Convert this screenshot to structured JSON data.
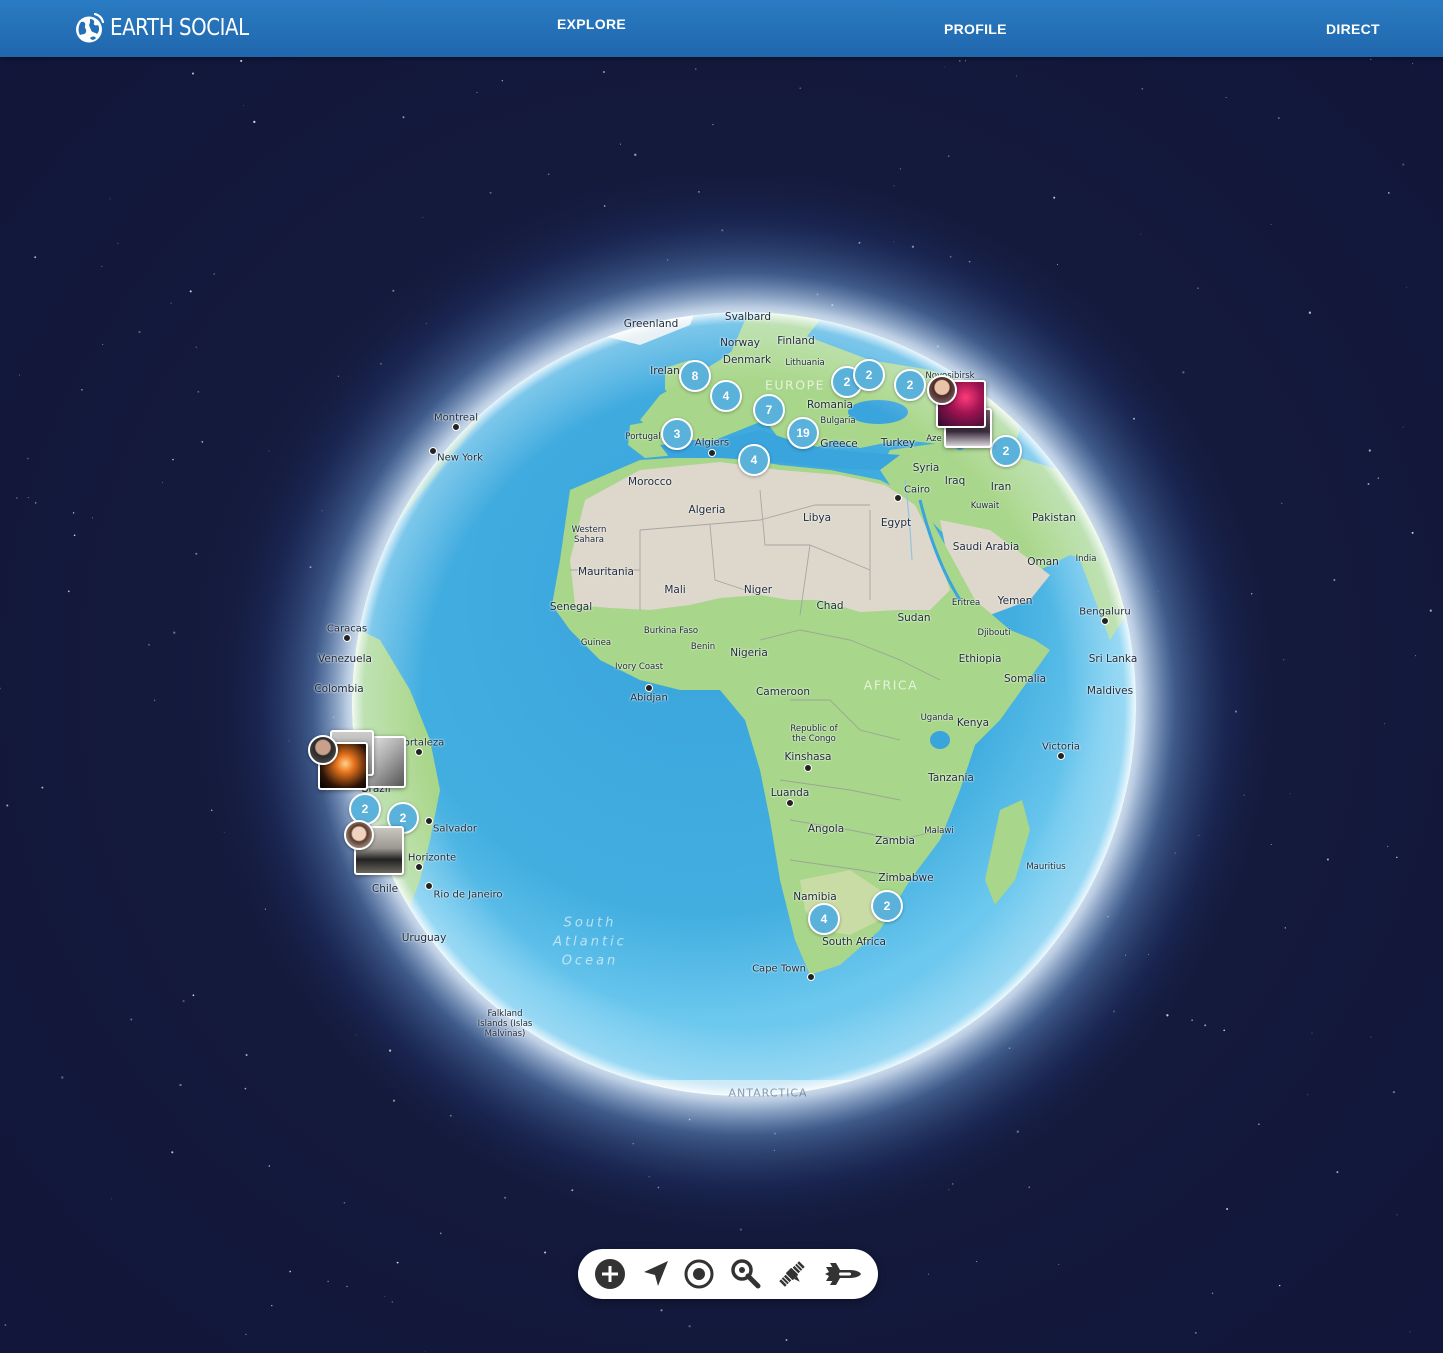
{
  "app": {
    "title": "EARTH SOCIAL",
    "logo_icon": "globe-icon"
  },
  "nav": {
    "explore": "EXPLORE",
    "profile": "PROFILE",
    "direct": "DIRECT"
  },
  "colors": {
    "header": "#2470b8",
    "space": "#141a3c",
    "ocean": "#3fa9dc",
    "land_green": "#a8d68a",
    "desert": "#dcd6cb",
    "cluster": "#5ab2db"
  },
  "globe": {
    "labels": {
      "greenland": "Greenland",
      "svalbard": "Svalbard",
      "finland": "Finland",
      "norway": "Norway",
      "denmark": "Denmark",
      "lithuania": "Lithuania",
      "ireland": "Irelan",
      "europe": "EUROPE",
      "novosibirsk": "Novosibirsk",
      "romania": "Romania",
      "bulgaria": "Bulgaria",
      "greece": "Greece",
      "turkey": "Turkey",
      "portugal": "Portugal",
      "algiers": "Algiers",
      "azerbaijan": "Aze",
      "montreal": "Montreal",
      "new_york": "New York",
      "syria": "Syria",
      "iraq": "Iraq",
      "iran": "Iran",
      "cairo": "Cairo",
      "morocco": "Morocco",
      "kuwait": "Kuwait",
      "pakistan": "Pakistan",
      "algeria": "Algeria",
      "libya": "Libya",
      "egypt": "Egypt",
      "western_sahara": "Western\nSahara",
      "saudi_arabia": "Saudi Arabia",
      "india": "India",
      "oman": "Oman",
      "mauritania": "Mauritania",
      "mali": "Mali",
      "niger": "Niger",
      "senegal": "Senegal",
      "chad": "Chad",
      "eritrea": "Eritrea",
      "yemen": "Yemen",
      "bengaluru": "Bengaluru",
      "sudan": "Sudan",
      "caracas": "Caracas",
      "guinea": "Guinea",
      "burkina_faso": "Burkina Faso",
      "benin": "Benin",
      "djibouti": "Djibouti",
      "nigeria": "Nigeria",
      "venezuela": "Venezuela",
      "ethiopia": "Ethiopia",
      "sri_lanka": "Sri Lanka",
      "ivory_coast": "Ivory Coast",
      "colombia": "Colombia",
      "abidjan": "Abidjan",
      "somalia": "Somalia",
      "cameroon": "Cameroon",
      "africa": "AFRICA",
      "maldives": "Maldives",
      "uganda": "Uganda",
      "kenya": "Kenya",
      "fortaleza": "ortaleza",
      "republic_congo": "Republic of\nthe Congo",
      "victoria": "Victoria",
      "kinshasa": "Kinshasa",
      "tanzania": "Tanzania",
      "brazil": "Brazil",
      "luanda": "Luanda",
      "salvador": "Salvador",
      "angola": "Angola",
      "malawi": "Malawi",
      "zambia": "Zambia",
      "belo_horizonte": "Horizonte",
      "mauritius": "Mauritius",
      "zimbabwe": "Zimbabwe",
      "chile": "Chile",
      "rio": "Rio de Janeiro",
      "namibia": "Namibia",
      "uruguay": "Uruguay",
      "south_atlantic": "South\nAtlantic\nOcean",
      "south_africa": "South Africa",
      "cape_town": "Cape Town",
      "falkland": "Falkland\nIslands (Islas\nMalvinas)",
      "antarctica": "ANTARCTICA"
    },
    "clusters": [
      {
        "id": "ireland",
        "count": "8"
      },
      {
        "id": "france",
        "count": "4"
      },
      {
        "id": "balkans",
        "count": "7"
      },
      {
        "id": "ukraine",
        "count": "2"
      },
      {
        "id": "russia-west",
        "count": "2"
      },
      {
        "id": "kazakhstan",
        "count": "2"
      },
      {
        "id": "spain",
        "count": "3"
      },
      {
        "id": "italy",
        "count": "19"
      },
      {
        "id": "tunisia",
        "count": "4"
      },
      {
        "id": "caucasus",
        "count": "2"
      },
      {
        "id": "brazil-north",
        "count": "2"
      },
      {
        "id": "brazil-east",
        "count": "2"
      },
      {
        "id": "namibia",
        "count": "4"
      },
      {
        "id": "mozambique",
        "count": "2"
      }
    ]
  },
  "toolbar": {
    "tools": [
      {
        "name": "add",
        "icon": "plus-circle-icon"
      },
      {
        "name": "navigate",
        "icon": "location-arrow-icon"
      },
      {
        "name": "locate",
        "icon": "target-icon"
      },
      {
        "name": "search",
        "icon": "search-icon"
      },
      {
        "name": "satellite",
        "icon": "satellite-icon"
      },
      {
        "name": "spaceship",
        "icon": "spaceship-icon"
      }
    ]
  }
}
